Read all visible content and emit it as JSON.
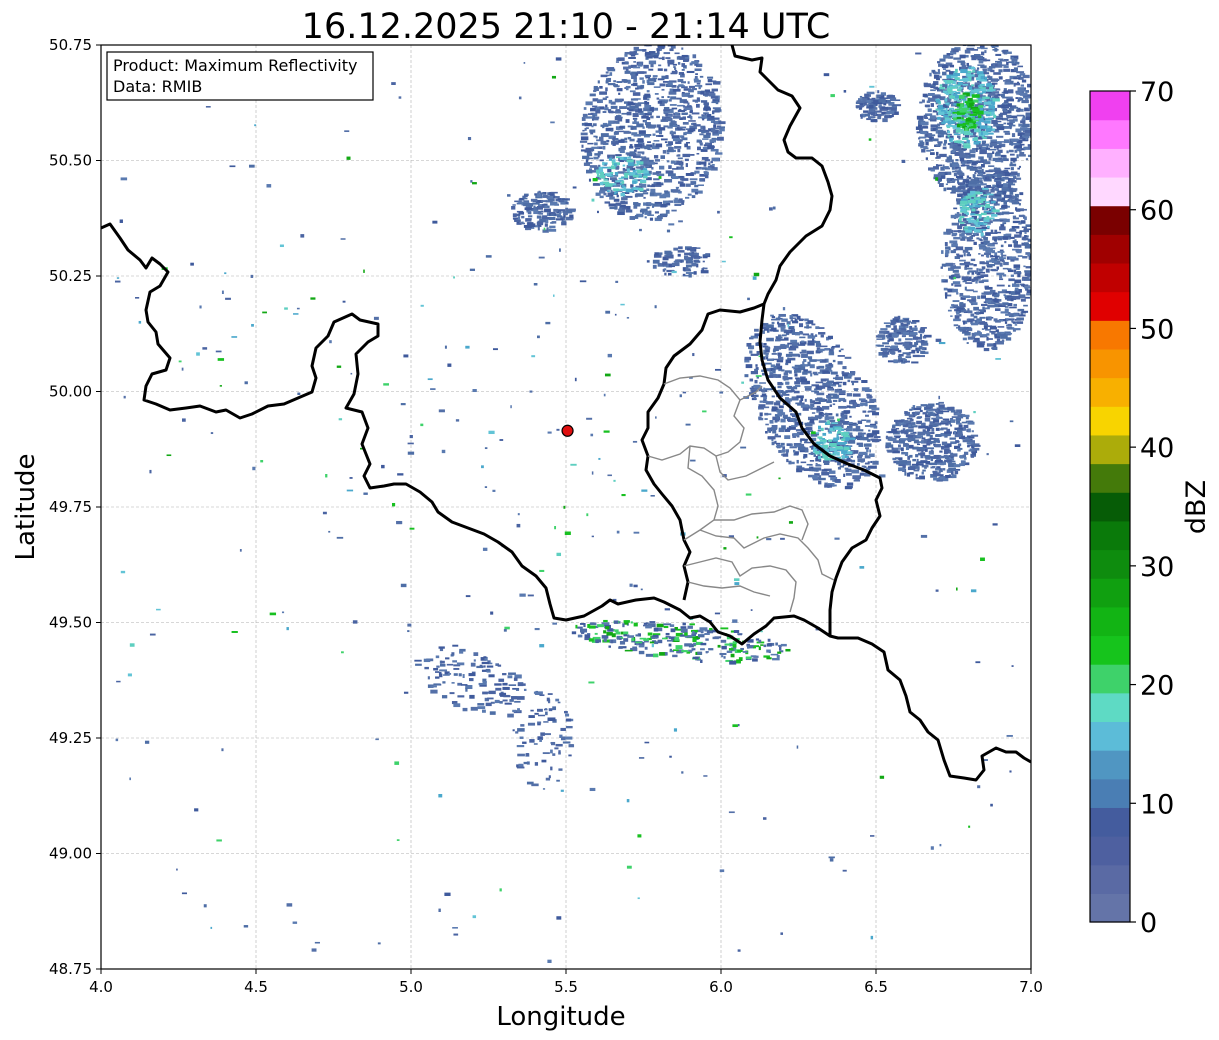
{
  "title": "16.12.2025 21:10 - 21:14 UTC",
  "xlabel": "Longitude",
  "ylabel": "Latitude",
  "info": {
    "product": "Product: Maximum Reflectivity",
    "data": "Data: RMIB"
  },
  "lon_range": [
    4.0,
    7.0
  ],
  "lat_range": [
    48.75,
    50.75
  ],
  "x_ticks": [
    "4.0",
    "4.5",
    "5.0",
    "5.5",
    "6.0",
    "6.5",
    "7.0"
  ],
  "y_ticks": [
    "50.75",
    "50.50",
    "50.25",
    "50.00",
    "49.75",
    "49.50",
    "49.25",
    "49.00",
    "48.75"
  ],
  "grid": true,
  "radar_site": {
    "lon": 5.505,
    "lat": 49.915,
    "color": "#e01010"
  },
  "colorbar": {
    "label": "dBZ",
    "ticks": [
      "0",
      "10",
      "20",
      "30",
      "40",
      "50",
      "60",
      "70"
    ],
    "colors": [
      "#6474a8",
      "#5a6aa4",
      "#4e60a0",
      "#445c9e",
      "#4a7eb4",
      "#5096c2",
      "#5cbcd8",
      "#5edac4",
      "#3ed26a",
      "#16c41c",
      "#12b414",
      "#10a010",
      "#0e8c0e",
      "#0a7a0a",
      "#065c06",
      "#447a0a",
      "#acac0a",
      "#f8d400",
      "#f8b000",
      "#f89400",
      "#f87800",
      "#e00000",
      "#c00000",
      "#a00000",
      "#7a0000",
      "#ffd8ff",
      "#ffb0ff",
      "#ff78ff",
      "#f040f0"
    ]
  }
}
